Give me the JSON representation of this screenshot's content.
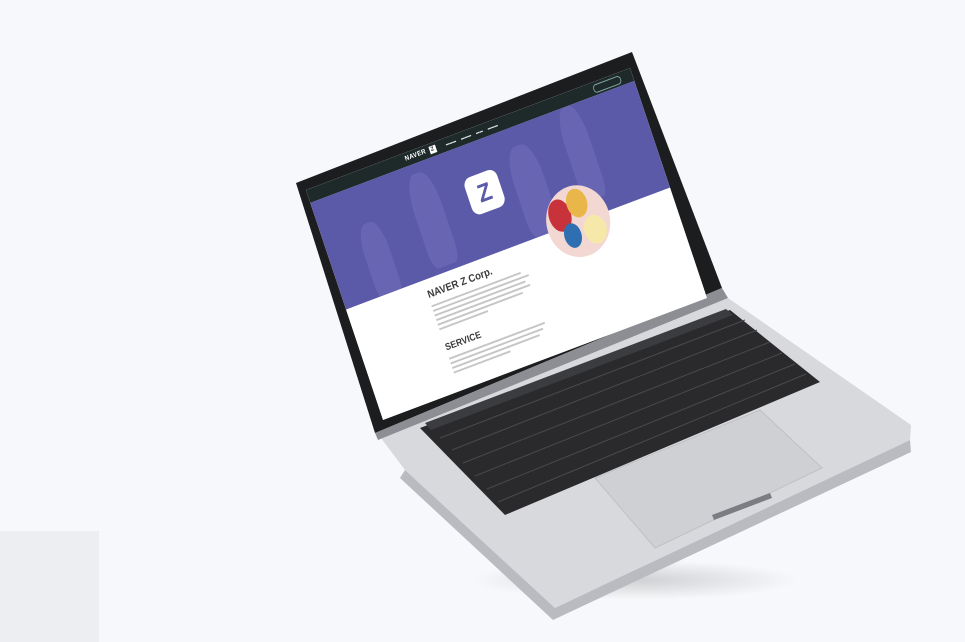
{
  "website": {
    "brand": "NAVER",
    "brand_mark": "Z",
    "hero_logo": "Z",
    "about_heading": "NAVER Z Corp.",
    "service_heading": "SERVICE"
  },
  "colors": {
    "hero_purple": "#5b5aa8",
    "nav_dark": "#1e2a2a",
    "laptop_silver": "#d6d7db",
    "keyboard_black": "#1d1d1f",
    "background": "#f7f8fb"
  },
  "icons": [
    "laptop",
    "keyboard",
    "trackpad",
    "z-logo",
    "avatar-illustration"
  ]
}
